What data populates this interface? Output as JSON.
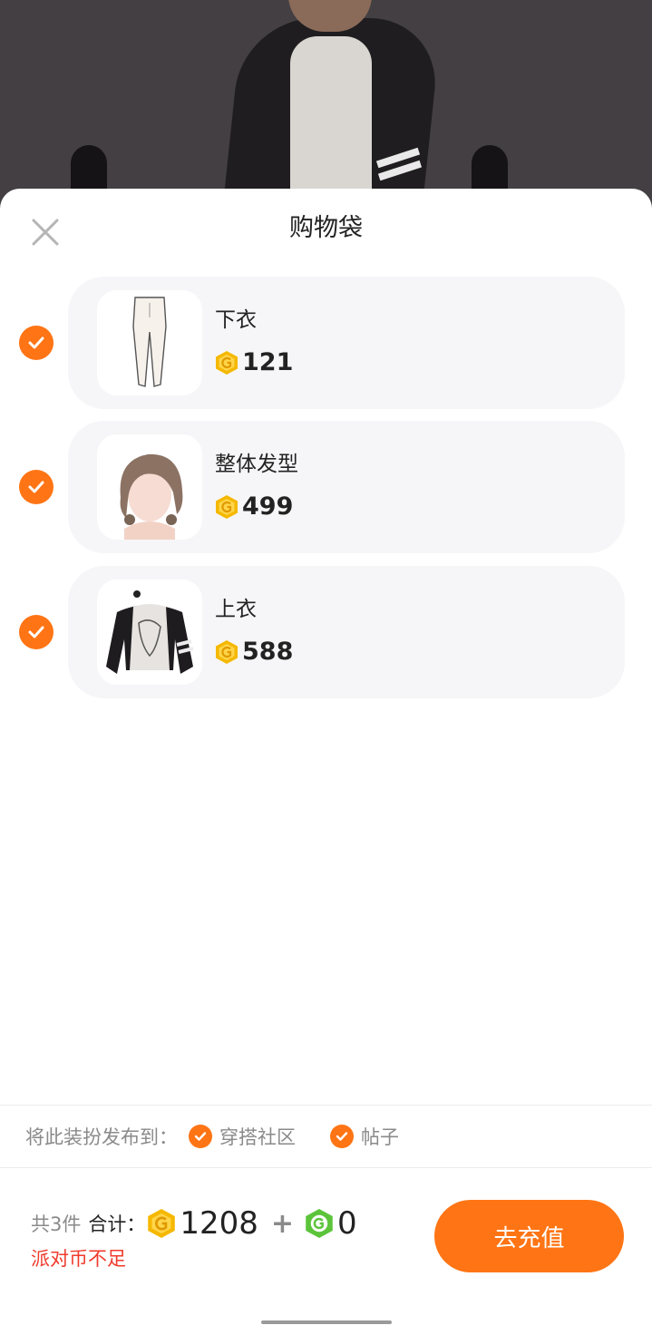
{
  "sheet": {
    "title": "购物袋"
  },
  "items": [
    {
      "name": "下衣",
      "price": "121",
      "checked": true
    },
    {
      "name": "整体发型",
      "price": "499",
      "checked": true
    },
    {
      "name": "上衣",
      "price": "588",
      "checked": true
    }
  ],
  "publish": {
    "label": "将此装扮发布到：",
    "options": [
      {
        "label": "穿搭社区",
        "checked": true
      },
      {
        "label": "帖子",
        "checked": true
      }
    ]
  },
  "summary": {
    "count_text": "共3件",
    "total_label": "合计：",
    "gold_total": "1208",
    "plus": "+",
    "green_total": "0",
    "warning": "派对币不足",
    "button_label": "去充值"
  },
  "colors": {
    "accent": "#ff7414",
    "warning": "#ef3b2c",
    "coin_gold": "#f5b800",
    "coin_green": "#5cc43a"
  },
  "icons": [
    "close-icon",
    "check-icon",
    "gold-coin-icon",
    "green-coin-icon"
  ]
}
